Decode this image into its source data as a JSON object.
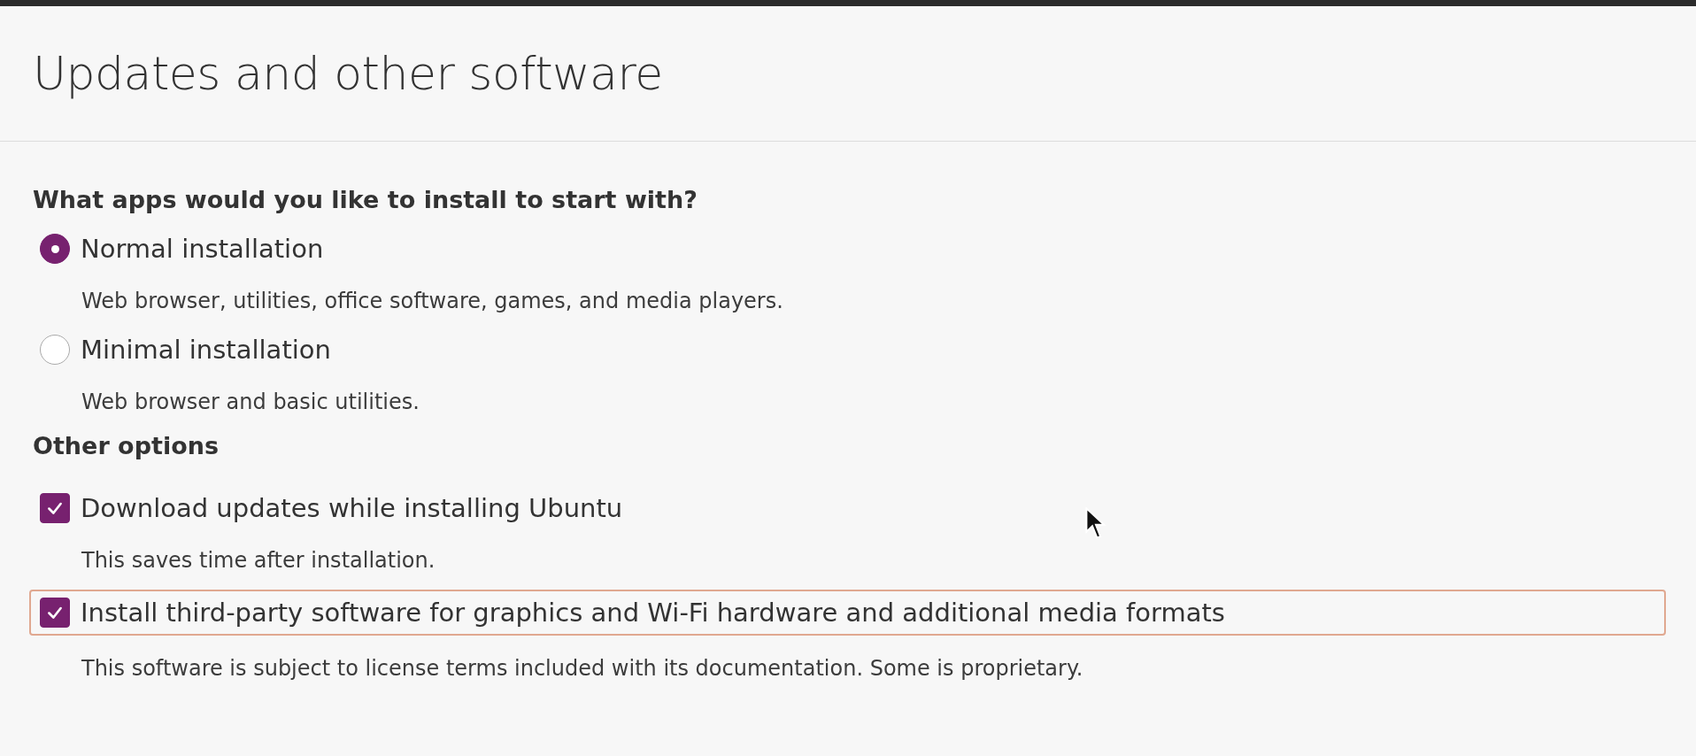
{
  "title": "Updates and other software",
  "sections": [
    {
      "heading": "What apps would you like to install to start with?",
      "options": [
        {
          "kind": "radio",
          "label": "Normal installation",
          "description": "Web browser, utilities, office software, games, and media players.",
          "selected": true
        },
        {
          "kind": "radio",
          "label": "Minimal installation",
          "description": "Web browser and basic utilities.",
          "selected": false
        }
      ]
    },
    {
      "heading": "Other options",
      "options": [
        {
          "kind": "checkbox",
          "label": "Download updates while installing Ubuntu",
          "description": "This saves time after installation.",
          "checked": true,
          "focused": false
        },
        {
          "kind": "checkbox",
          "label": "Install third-party software for graphics and Wi-Fi hardware and additional media formats",
          "description": "This software is subject to license terms included with its documentation. Some is proprietary.",
          "checked": true,
          "focused": true
        }
      ]
    }
  ]
}
